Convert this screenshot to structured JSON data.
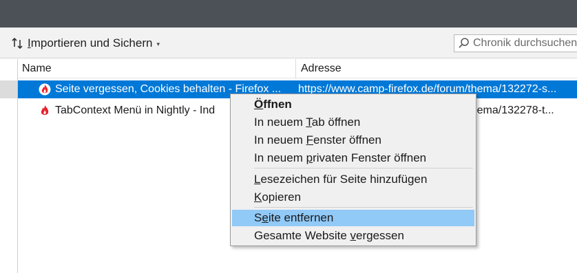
{
  "toolbar": {
    "import_label_before": "",
    "import_label_accel": "I",
    "import_label_after": "mportieren und Sichern",
    "import_icon": "import-export-arrows-icon",
    "dropdown_icon": "chevron-down-icon"
  },
  "search": {
    "placeholder": "Chronik durchsuchen",
    "icon": "search-icon"
  },
  "table": {
    "columns": [
      "Name",
      "Adresse"
    ],
    "rows": [
      {
        "name": "Seite vergessen, Cookies behalten - Firefox ...",
        "address": "https://www.camp-firefox.de/forum/thema/132272-s...",
        "icon": "camp-firefox-favicon",
        "selected": true
      },
      {
        "name": "TabContext Menü in Nightly - Ind",
        "address": "https://www.camp-firefox.de/forum/thema/132278-t...",
        "icon": "camp-firefox-favicon",
        "selected": false
      }
    ]
  },
  "context_menu": {
    "items": [
      {
        "pre": "",
        "accel": "Ö",
        "post": "ffnen",
        "bold": true
      },
      {
        "pre": "In neuem ",
        "accel": "T",
        "post": "ab öffnen"
      },
      {
        "pre": "In neuem ",
        "accel": "F",
        "post": "enster öffnen"
      },
      {
        "pre": "In neuem ",
        "accel": "p",
        "post": "rivaten Fenster öffnen"
      },
      {
        "pre": "",
        "accel": "L",
        "post": "esezeichen für Seite hinzufügen"
      },
      {
        "pre": "",
        "accel": "K",
        "post": "opieren"
      },
      {
        "pre": "S",
        "accel": "e",
        "post": "ite entfernen",
        "highlighted": true
      },
      {
        "pre": "Gesamte Website ",
        "accel": "v",
        "post": "ergessen"
      }
    ]
  },
  "colors": {
    "titlebar": "#4b5156",
    "selection": "#0078d7",
    "menu_highlight": "#91c9f7"
  }
}
